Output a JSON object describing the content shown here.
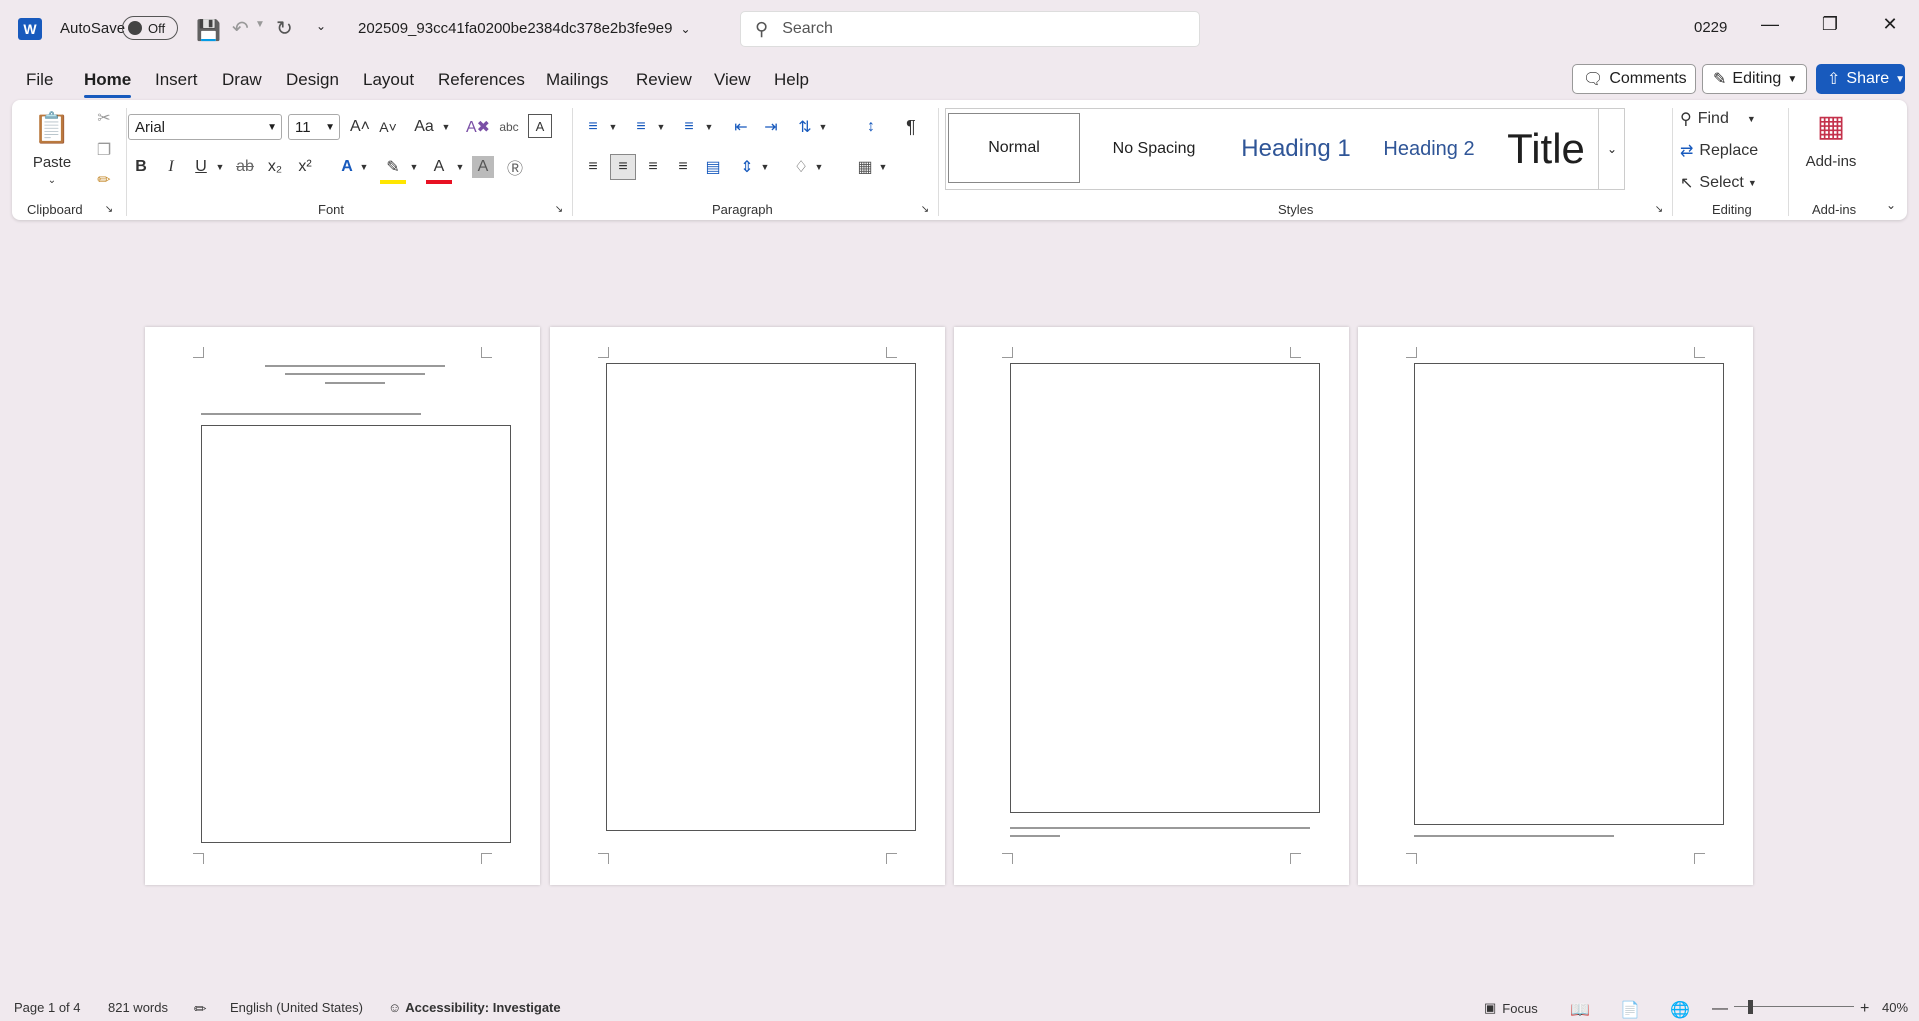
{
  "titlebar": {
    "app_icon": "W",
    "autosave_label": "AutoSave",
    "autosave_state": "Off",
    "doc_title": "202509_93cc41fa0200be2384dc378e2b3fe9e9",
    "search_placeholder": "Search",
    "user": "0229"
  },
  "menu": {
    "items": [
      "File",
      "Home",
      "Insert",
      "Draw",
      "Design",
      "Layout",
      "References",
      "Mailings",
      "Review",
      "View",
      "Help"
    ],
    "active": "Home",
    "comments": "Comments",
    "editing": "Editing",
    "share": "Share"
  },
  "ribbon": {
    "clipboard": {
      "paste": "Paste",
      "label": "Clipboard"
    },
    "font": {
      "name": "Arial",
      "size": "11",
      "label": "Font",
      "aa": "Aa"
    },
    "paragraph": {
      "label": "Paragraph"
    },
    "styles": {
      "items": [
        "Normal",
        "No Spacing",
        "Heading 1",
        "Heading 2",
        "Title"
      ],
      "label": "Styles"
    },
    "editing": {
      "find": "Find",
      "replace": "Replace",
      "select": "Select",
      "label": "Editing"
    },
    "addins": {
      "button": "Add-ins",
      "label": "Add-ins"
    }
  },
  "status": {
    "page": "Page 1 of 4",
    "words": "821 words",
    "language": "English (United States)",
    "accessibility": "Accessibility: Investigate",
    "focus": "Focus",
    "zoom": "40%"
  },
  "colors": {
    "accent": "#185abd",
    "background": "#f0e9ee"
  }
}
